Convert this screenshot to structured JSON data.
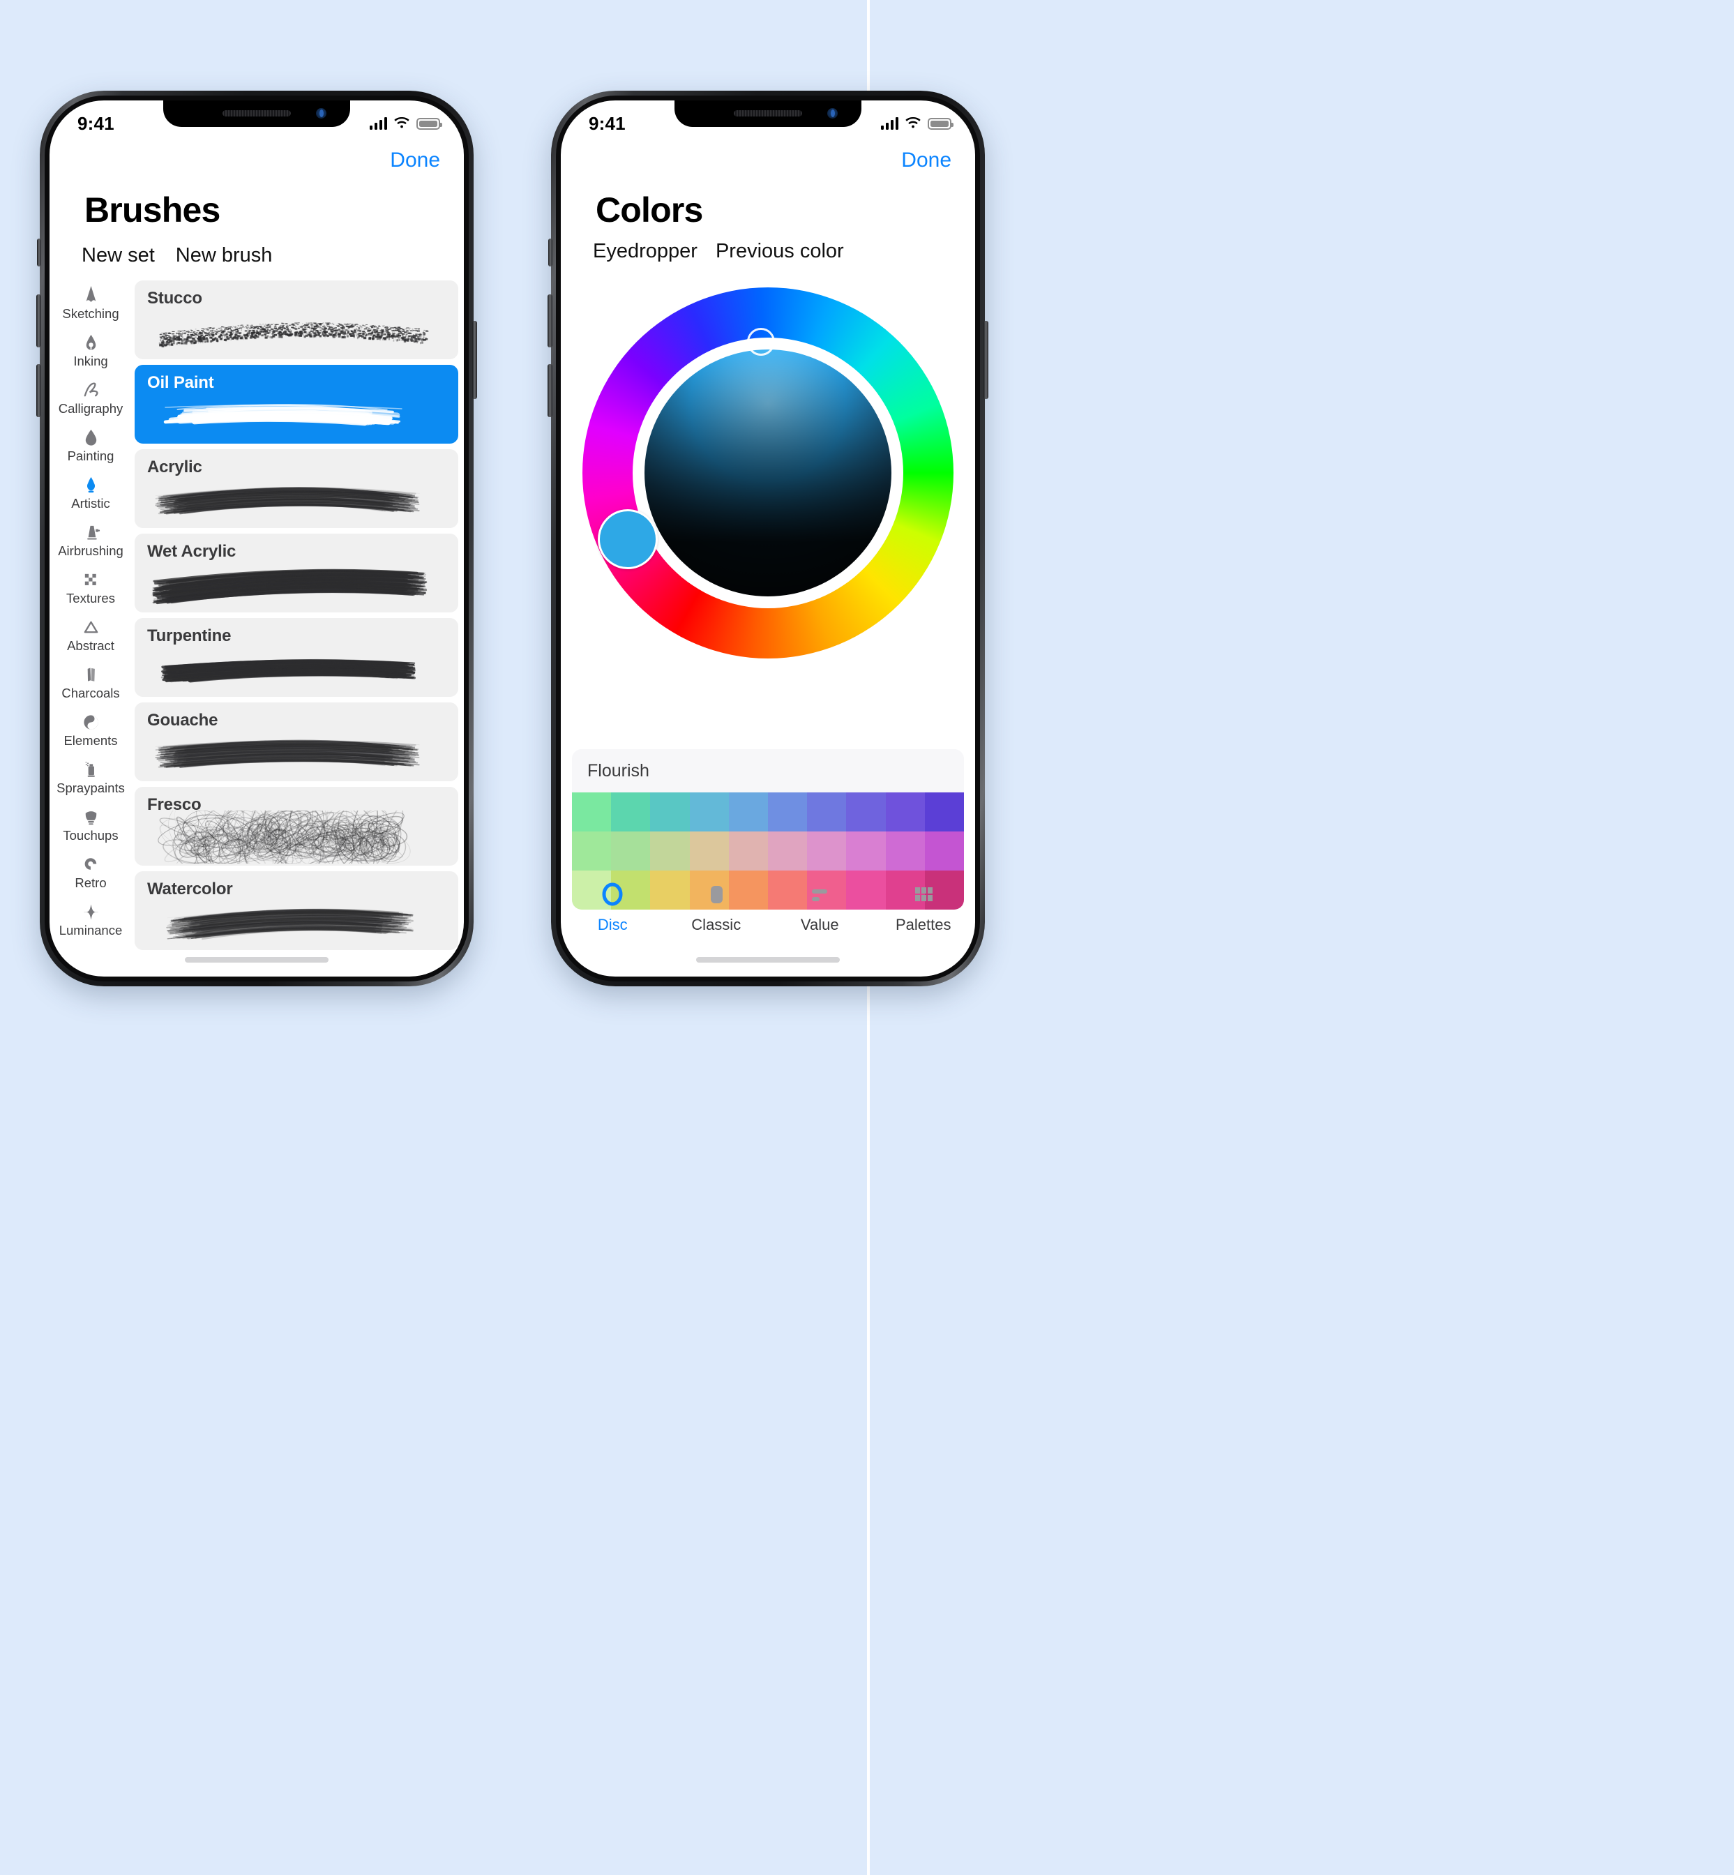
{
  "background_color": "#ddeafb",
  "accent_color": "#0b84ff",
  "selected_brush_color": "#0c8bf2",
  "status_bar": {
    "time": "9:41",
    "cellular_icon": "signal-bars-icon",
    "wifi_icon": "wifi-icon",
    "battery_icon": "battery-icon"
  },
  "brushes_screen": {
    "done_label": "Done",
    "title": "Brushes",
    "toolbar": {
      "new_set_label": "New set",
      "new_brush_label": "New brush"
    },
    "categories": [
      {
        "label": "Sketching",
        "icon": "pencil-tip-icon",
        "selected": false
      },
      {
        "label": "Inking",
        "icon": "pen-nib-icon",
        "selected": false
      },
      {
        "label": "Calligraphy",
        "icon": "script-stroke-icon",
        "selected": false
      },
      {
        "label": "Painting",
        "icon": "paint-drop-icon",
        "selected": false
      },
      {
        "label": "Artistic",
        "icon": "brush-flame-icon",
        "selected": true
      },
      {
        "label": "Airbrushing",
        "icon": "airbrush-icon",
        "selected": false
      },
      {
        "label": "Textures",
        "icon": "checker-icon",
        "selected": false
      },
      {
        "label": "Abstract",
        "icon": "triangle-icon",
        "selected": false
      },
      {
        "label": "Charcoals",
        "icon": "charcoal-stick-icon",
        "selected": false
      },
      {
        "label": "Elements",
        "icon": "yin-yang-icon",
        "selected": false
      },
      {
        "label": "Spraypaints",
        "icon": "spray-can-icon",
        "selected": false
      },
      {
        "label": "Touchups",
        "icon": "fan-brush-icon",
        "selected": false
      },
      {
        "label": "Retro",
        "icon": "retro-swirl-icon",
        "selected": false
      },
      {
        "label": "Luminance",
        "icon": "sparkle-icon",
        "selected": false
      }
    ],
    "brushes": [
      {
        "name": "Stucco",
        "selected": false,
        "stroke": "stucco"
      },
      {
        "name": "Oil Paint",
        "selected": true,
        "stroke": "oilpaint"
      },
      {
        "name": "Acrylic",
        "selected": false,
        "stroke": "acrylic"
      },
      {
        "name": "Wet Acrylic",
        "selected": false,
        "stroke": "wetacrylic"
      },
      {
        "name": "Turpentine",
        "selected": false,
        "stroke": "turpentine"
      },
      {
        "name": "Gouache",
        "selected": false,
        "stroke": "gouache"
      },
      {
        "name": "Fresco",
        "selected": false,
        "stroke": "fresco"
      },
      {
        "name": "Watercolor",
        "selected": false,
        "stroke": "watercolor"
      }
    ]
  },
  "colors_screen": {
    "done_label": "Done",
    "title": "Colors",
    "toolbar": {
      "eyedropper_label": "Eyedropper",
      "previous_color_label": "Previous color"
    },
    "color_wheel": {
      "selected_hue_color": "#2ea8e6",
      "hue_handle_name": "hue-ring-handle",
      "sv_handle_name": "saturation-value-handle"
    },
    "palette": {
      "name": "Flourish",
      "rows": [
        [
          "#7ae8a0",
          "#5cd6ae",
          "#59c7c4",
          "#63b9d8",
          "#6aa8e0",
          "#6f8fe2",
          "#6f78e0",
          "#6f63de",
          "#6f52dc",
          "#5b3fd6"
        ],
        [
          "#9fe89a",
          "#a6e09a",
          "#c2d69a",
          "#dcc79c",
          "#e0b3b0",
          "#e0a4c0",
          "#dd93cc",
          "#d97fd2",
          "#cf6bd4",
          "#c455d2"
        ],
        [
          "#ccf0a8",
          "#c2e06e",
          "#e8cf63",
          "#f2b45e",
          "#f5955f",
          "#f57a74",
          "#f05f8e",
          "#eb4f9f",
          "#e0408f",
          "#c9317a"
        ]
      ]
    },
    "tabs": [
      {
        "label": "Disc",
        "icon": "disc-ring-icon",
        "selected": true
      },
      {
        "label": "Classic",
        "icon": "rounded-square-icon",
        "selected": false
      },
      {
        "label": "Value",
        "icon": "sliders-icon",
        "selected": false
      },
      {
        "label": "Palettes",
        "icon": "grid-icon",
        "selected": false
      }
    ]
  }
}
